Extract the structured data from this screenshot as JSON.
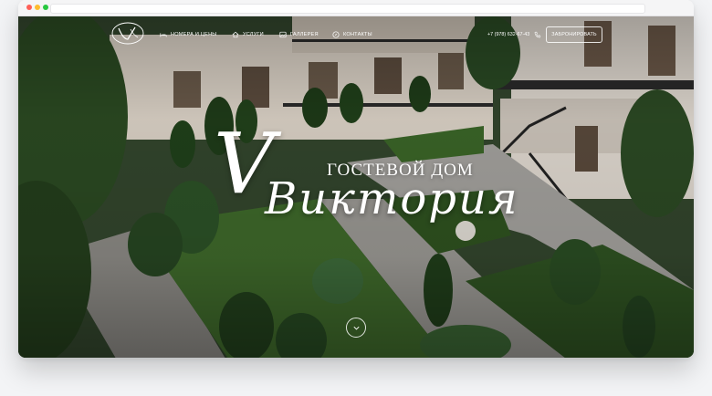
{
  "nav": {
    "items": [
      {
        "label": "НОМЕРА И ЦЕНЫ",
        "icon": "bed-icon"
      },
      {
        "label": "УСЛУГИ",
        "icon": "home-icon"
      },
      {
        "label": "ГАЛЛЕРЕЯ",
        "icon": "image-icon"
      },
      {
        "label": "КОНТАКТЫ",
        "icon": "compass-icon"
      }
    ],
    "phone": "+7 (978) 632-67-43",
    "book_label": "ЗАБРОНИРОВАТЬ"
  },
  "hero": {
    "initial": "V",
    "subtitle": "ГОСТЕВОЙ ДОМ",
    "title": "Виктория"
  },
  "icons": {
    "logo": "victoria-monogram-logo",
    "scroll": "chevron-down-icon"
  },
  "colors": {
    "overlay": "#000000",
    "text": "#ffffff",
    "lawn": "#3f6a2b",
    "building": "#e7e0d6"
  }
}
